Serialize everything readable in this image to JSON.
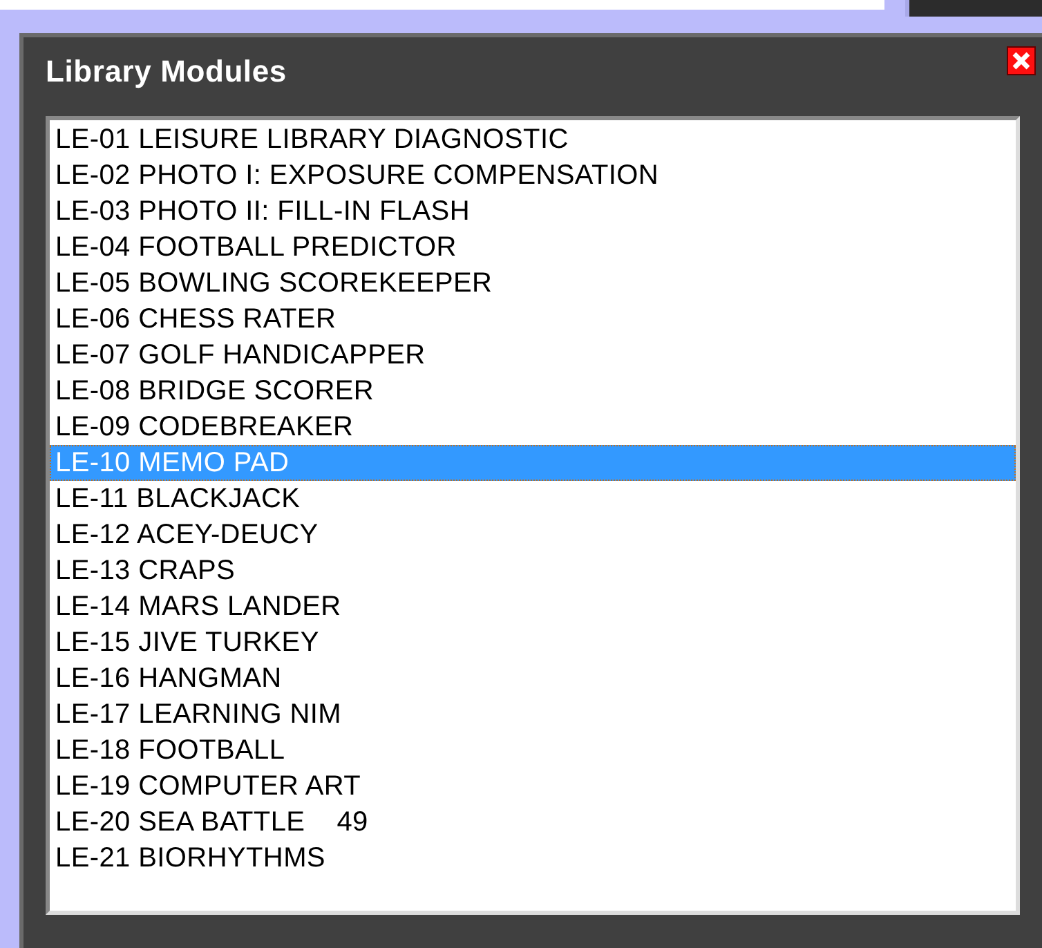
{
  "window": {
    "title": "Library Modules"
  },
  "list": {
    "items": [
      {
        "label": "LE-01 LEISURE LIBRARY DIAGNOSTIC",
        "selected": false
      },
      {
        "label": "LE-02 PHOTO I: EXPOSURE COMPENSATION",
        "selected": false
      },
      {
        "label": "LE-03 PHOTO II: FILL-IN FLASH",
        "selected": false
      },
      {
        "label": "LE-04 FOOTBALL PREDICTOR",
        "selected": false
      },
      {
        "label": "LE-05 BOWLING SCOREKEEPER",
        "selected": false
      },
      {
        "label": "LE-06 CHESS RATER",
        "selected": false
      },
      {
        "label": "LE-07 GOLF HANDICAPPER",
        "selected": false
      },
      {
        "label": "LE-08 BRIDGE SCORER",
        "selected": false
      },
      {
        "label": "LE-09 CODEBREAKER",
        "selected": false
      },
      {
        "label": "LE-10 MEMO PAD",
        "selected": true
      },
      {
        "label": "LE-11 BLACKJACK",
        "selected": false
      },
      {
        "label": "LE-12 ACEY-DEUCY",
        "selected": false
      },
      {
        "label": "LE-13 CRAPS",
        "selected": false
      },
      {
        "label": "LE-14 MARS LANDER",
        "selected": false
      },
      {
        "label": "LE-15 JIVE TURKEY",
        "selected": false
      },
      {
        "label": "LE-16 HANGMAN",
        "selected": false
      },
      {
        "label": "LE-17 LEARNING NIM",
        "selected": false
      },
      {
        "label": "LE-18 FOOTBALL",
        "selected": false
      },
      {
        "label": "LE-19 COMPUTER ART",
        "selected": false
      },
      {
        "label": "LE-20 SEA BATTLE    49",
        "selected": false
      },
      {
        "label": "LE-21 BIORHYTHMS",
        "selected": false
      }
    ]
  }
}
